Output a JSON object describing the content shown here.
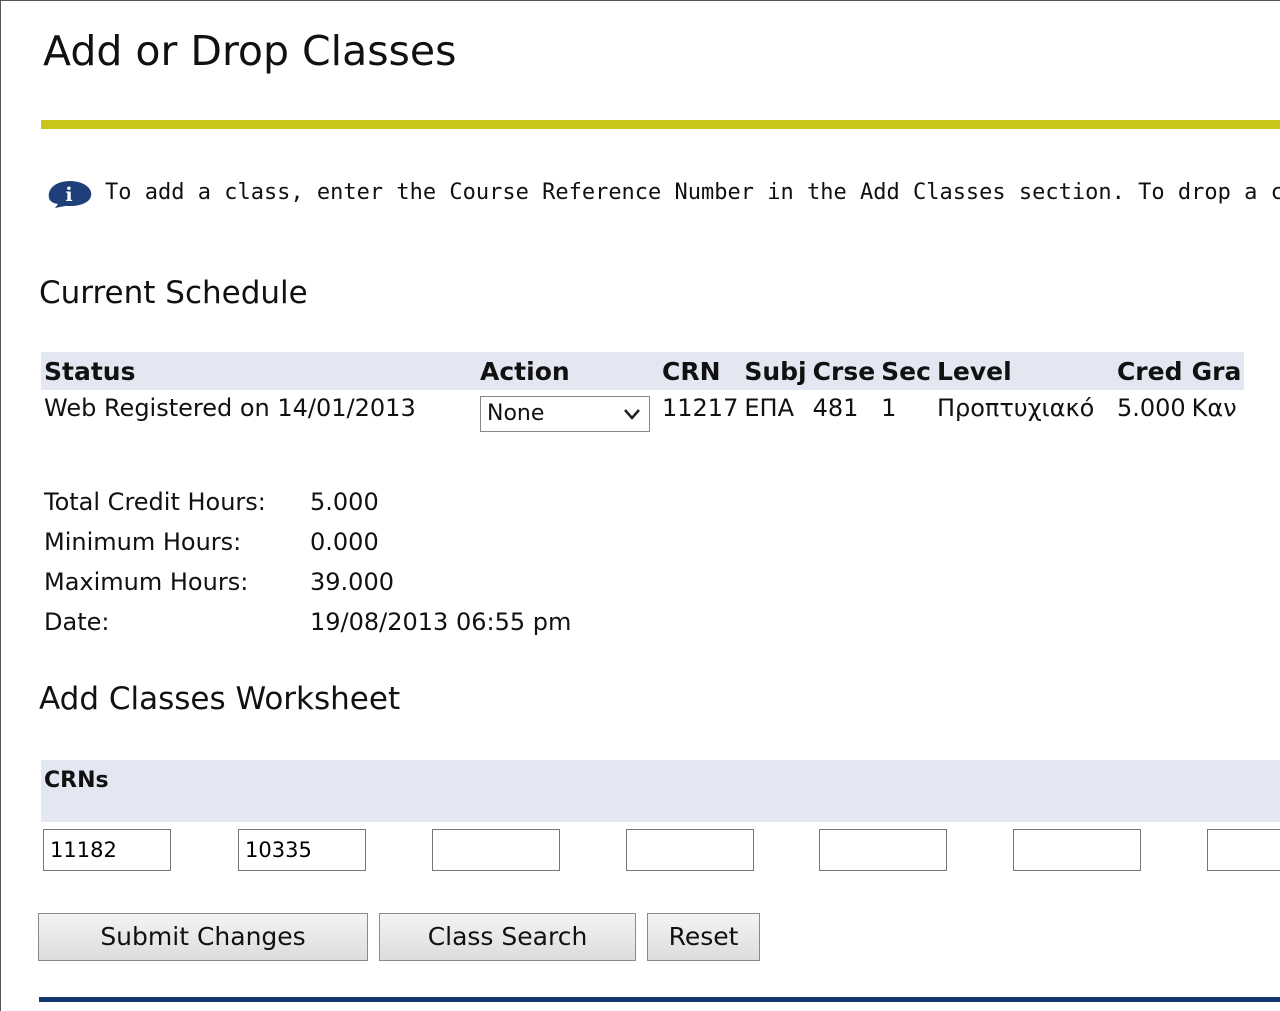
{
  "page": {
    "title": "Add or Drop Classes",
    "info_text": "To add a class, enter the Course Reference Number in the Add Classes section. To drop a cla"
  },
  "current_schedule": {
    "heading": "Current Schedule",
    "columns": [
      "Status",
      "Action",
      "CRN",
      "Subj",
      "Crse",
      "Sec",
      "Level",
      "Cred",
      "Gra"
    ],
    "rows": [
      {
        "status": "Web Registered on 14/01/2013",
        "action": "None",
        "crn": "11217",
        "subj": "ΕΠΑ",
        "crse": "481",
        "sec": "1",
        "level": "Προπτυχιακό",
        "cred": "5.000",
        "gra": "Καν"
      }
    ]
  },
  "summary": {
    "total_credit_label": "Total Credit Hours:",
    "total_credit_value": "5.000",
    "min_hours_label": "Minimum Hours:",
    "min_hours_value": "0.000",
    "max_hours_label": "Maximum Hours:",
    "max_hours_value": "39.000",
    "date_label": "Date:",
    "date_value": "19/08/2013 06:55 pm"
  },
  "worksheet": {
    "heading": "Add Classes Worksheet",
    "crns_label": "CRNs",
    "crn_values": [
      "11182",
      "10335",
      "",
      "",
      "",
      "",
      ""
    ]
  },
  "buttons": {
    "submit": "Submit Changes",
    "search": "Class Search",
    "reset": "Reset"
  },
  "colors": {
    "title_rule": "#c9c61a",
    "table_header_bg": "#e3e7f1",
    "bottom_rule": "#13386f",
    "info_icon": "#1f3f7a"
  },
  "icons": {
    "info": "info-icon",
    "dropdown": "chevron-down-icon"
  }
}
